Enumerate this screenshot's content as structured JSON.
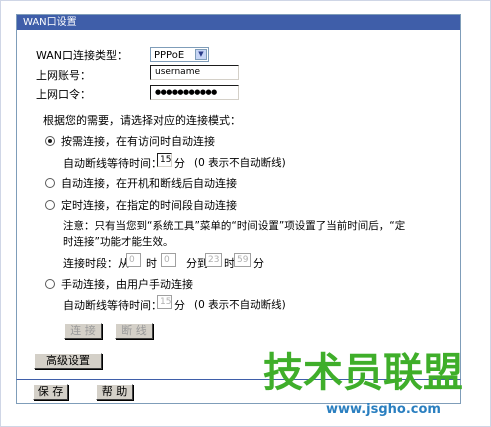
{
  "panel": {
    "title": "WAN口设置"
  },
  "connection_type": {
    "label": "WAN口连接类型：",
    "value": "PPPoE"
  },
  "account": {
    "label": "上网账号：",
    "value": "username"
  },
  "password": {
    "label": "上网口令：",
    "value": "●●●●●●●●●●●"
  },
  "mode_prompt": "根据您的需要，请选择对应的连接模式：",
  "mode_on_demand": {
    "label": "按需连接，在有访问时自动连接",
    "wait_label": "自动断线等待时间：",
    "wait_value": "15",
    "wait_unit": "分",
    "wait_hint": "(0 表示不自动断线)",
    "checked": true
  },
  "mode_auto": {
    "label": "自动连接，在开机和断线后自动连接",
    "checked": false
  },
  "mode_timed": {
    "label": "定时连接，在指定的时间段自动连接",
    "note_line1": "注意：只有当您到“系统工具”菜单的“时间设置”项设置了当前时间后，“定",
    "note_line2": "时连接”功能才能生效。",
    "period_label": "连接时段：从",
    "from_hour": "0",
    "hour_unit": "时",
    "from_minute": "0",
    "to_label": "分到",
    "to_hour": "23",
    "to_minute": "59",
    "minute_unit": "分",
    "checked": false
  },
  "mode_manual": {
    "label": "手动连接，由用户手动连接",
    "wait_label": "自动断线等待时间：",
    "wait_value": "15",
    "wait_unit": "分",
    "wait_hint": "(0 表示不自动断线)",
    "checked": false
  },
  "buttons": {
    "connect": "连 接",
    "disconnect": "断 线",
    "advanced": "高级设置",
    "save": "保 存",
    "help": "帮 助"
  },
  "watermark": {
    "brand": "技术员联盟",
    "url": "www.jsgho.com"
  },
  "colors": {
    "title_bar": "#3f5ea9",
    "border": "#7f9db9",
    "watermark_green": "#3fae2a",
    "watermark_blue": "#2a7fc0"
  }
}
